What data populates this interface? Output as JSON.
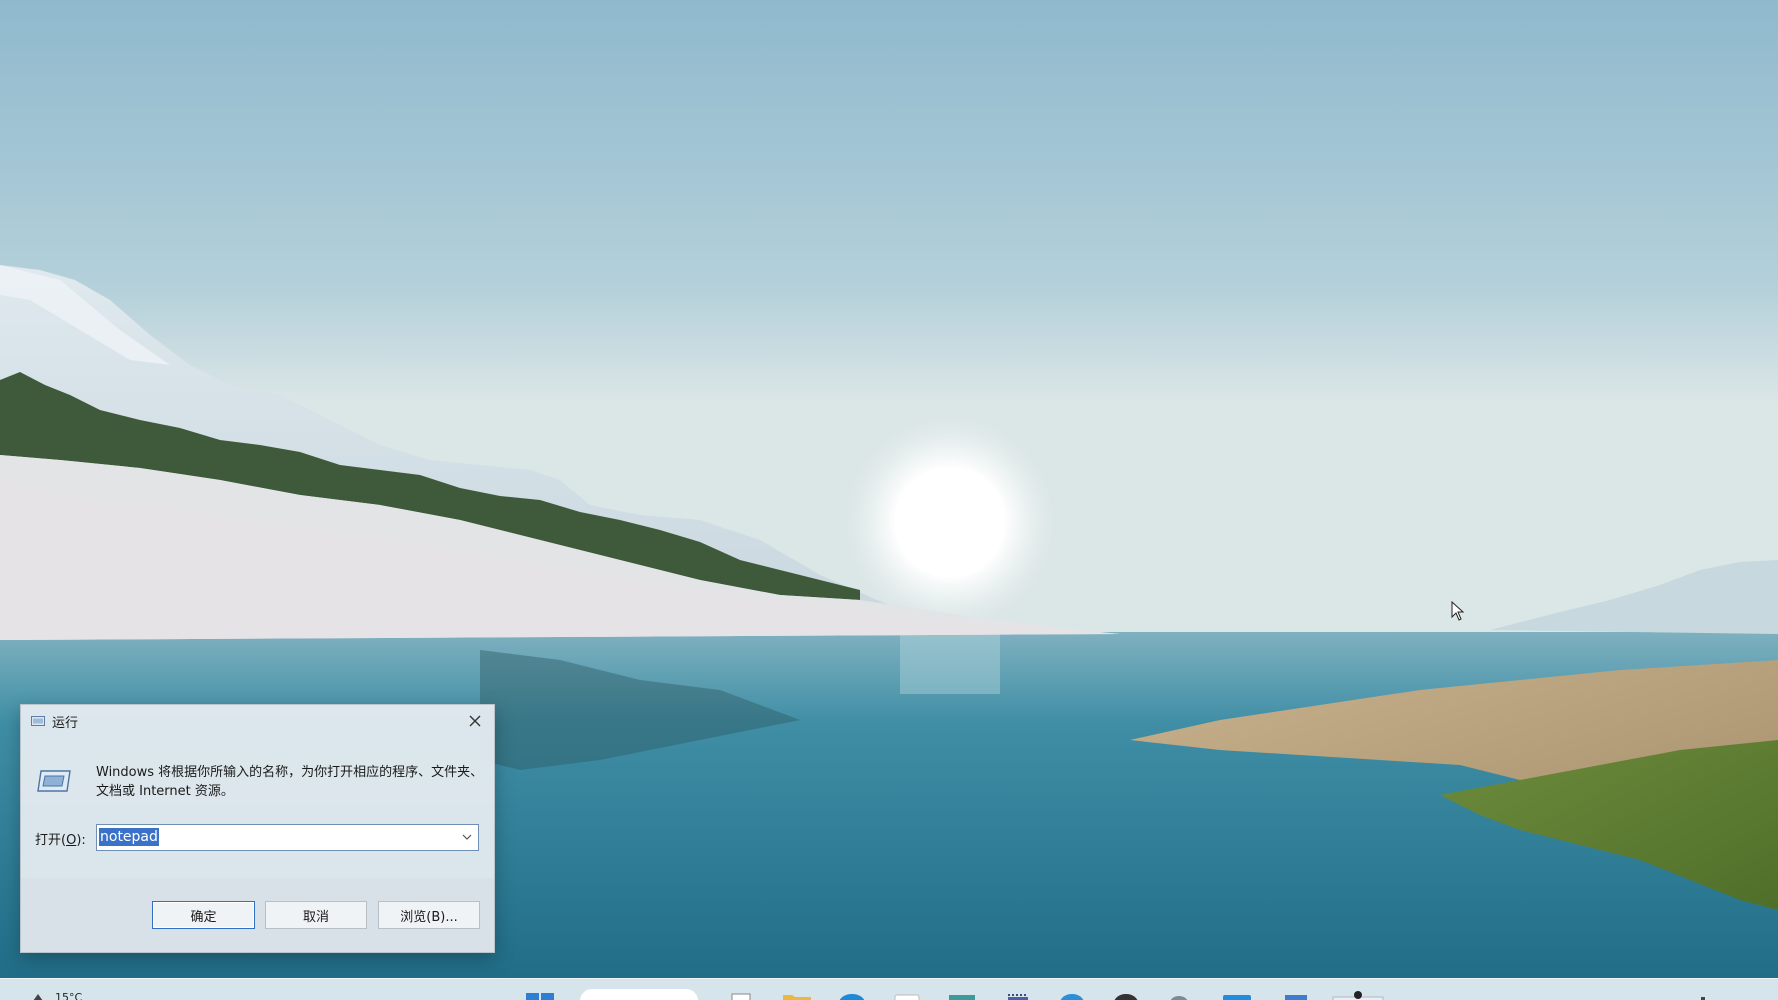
{
  "run_dialog": {
    "title": "运行",
    "description": "Windows 将根据你所输入的名称，为你打开相应的程序、文件夹、文档或 Internet 资源。",
    "open_label_prefix": "打开(",
    "open_label_key": "O",
    "open_label_suffix": "):",
    "input_value": "notepad",
    "ok_label": "确定",
    "cancel_label": "取消",
    "browse_label": "浏览(B)..."
  },
  "taskbar": {
    "weather_temp": "15°C",
    "icons": [
      "start-icon",
      "search-box",
      "task-view-icon",
      "file-explorer-icon",
      "edge-icon",
      "store-icon",
      "terminal-icon",
      "calendar-icon",
      "chrome-icon",
      "app-icon",
      "settings-icon",
      "mail-icon",
      "photos-icon",
      "paint-icon"
    ]
  },
  "colors": {
    "sky_top": "#93bccf",
    "water": "#2f7f95",
    "selection": "#3a72c9"
  }
}
